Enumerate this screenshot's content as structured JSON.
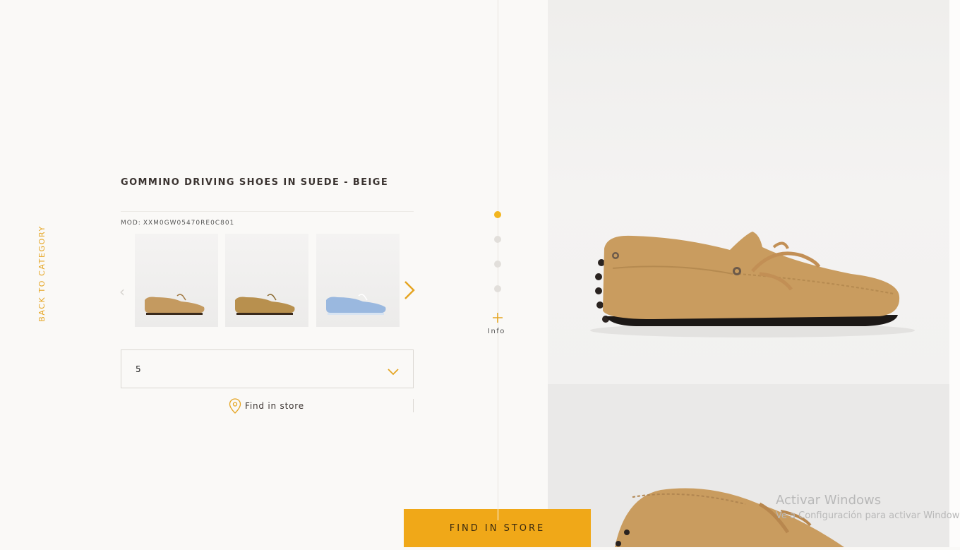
{
  "nav": {
    "back_label": "BACK TO CATEGORY"
  },
  "product": {
    "title": "GOMMINO DRIVING SHOES IN SUEDE - BEIGE",
    "model_label": "MOD:",
    "model_code": "XXM0GW05470RE0C801"
  },
  "thumbnails": [
    {
      "alt": "Beige suede driving shoe",
      "color": "#c49a60"
    },
    {
      "alt": "Tan suede driving shoe",
      "color": "#b8904e"
    },
    {
      "alt": "Light blue suede driving shoe",
      "color": "#9ab8df"
    }
  ],
  "size_selector": {
    "value": "5"
  },
  "find_in_store_link": "Find in store",
  "gallery_nav": {
    "active_index": 0,
    "dot_count": 4,
    "info_label": "Info"
  },
  "cta": {
    "label": "FIND IN STORE"
  },
  "system_overlay": {
    "title": "Activar Windows",
    "subtitle": "Ve a Configuración para activar Windows."
  },
  "colors": {
    "accent": "#f2b51f",
    "cta_background": "#f0a818",
    "background": "#faf9f7",
    "shoe_suede": "#c99c5f"
  },
  "icons": [
    "chevron-left-icon",
    "chevron-right-icon",
    "chevron-down-icon",
    "location-pin-icon",
    "plus-icon"
  ]
}
